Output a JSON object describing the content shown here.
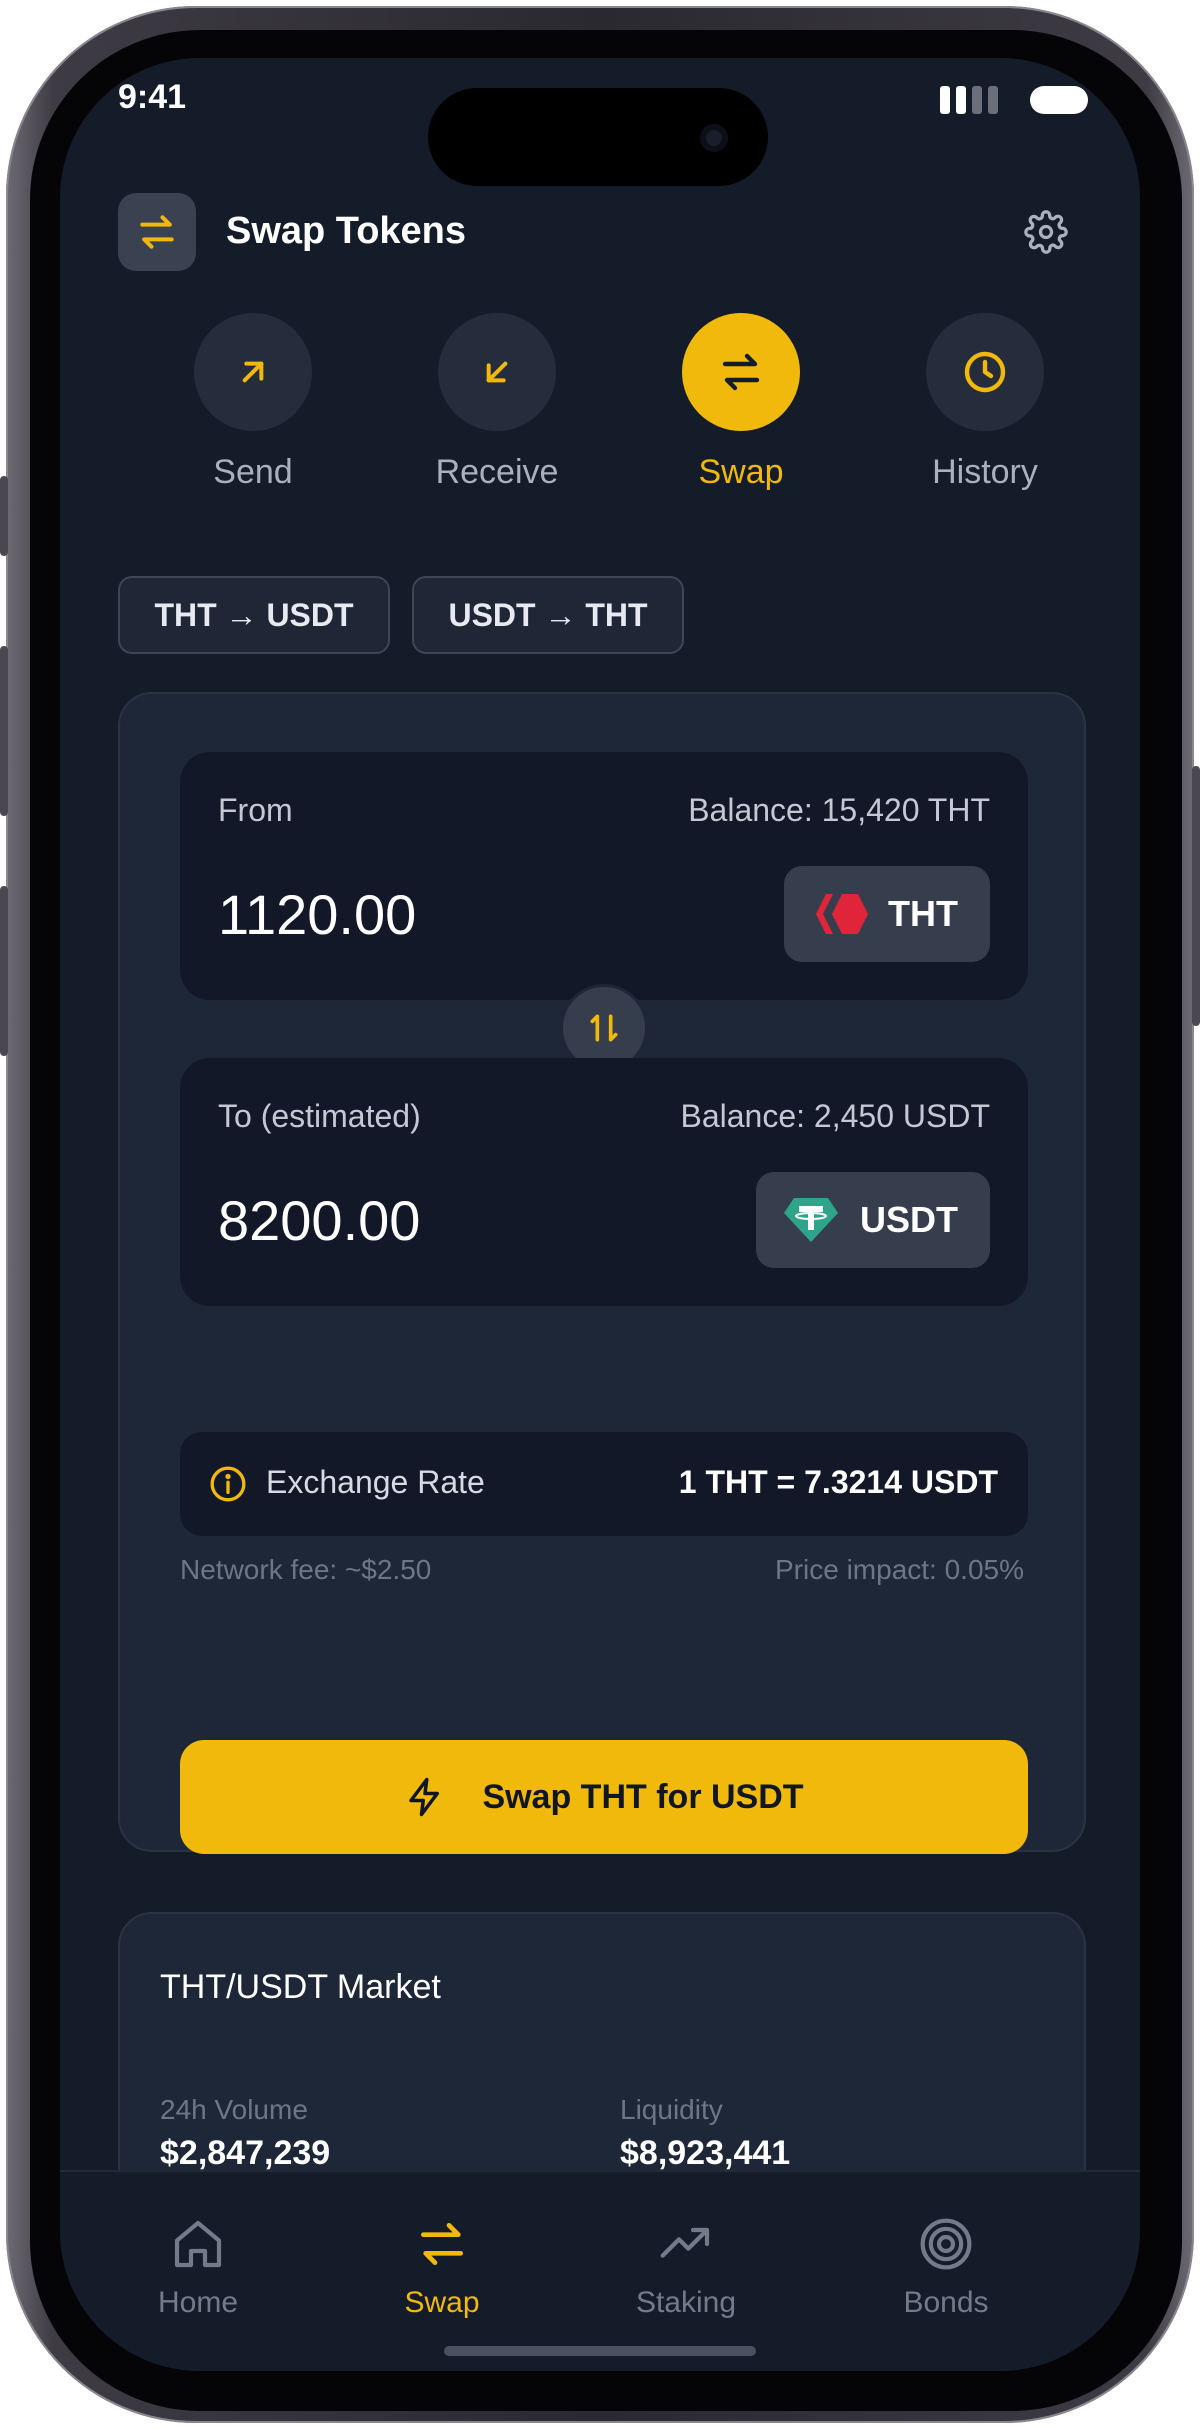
{
  "status_bar": {
    "time": "9:41"
  },
  "header": {
    "title": "Swap Tokens",
    "icon": "swap-arrows-icon",
    "settings_icon": "gear-icon"
  },
  "quick_actions": [
    {
      "label": "Send",
      "icon": "arrow-up-right-icon",
      "active": false
    },
    {
      "label": "Receive",
      "icon": "arrow-down-left-icon",
      "active": false
    },
    {
      "label": "Swap",
      "icon": "swap-arrows-icon",
      "active": true
    },
    {
      "label": "History",
      "icon": "clock-icon",
      "active": false
    }
  ],
  "pair_chips": [
    "THT → USDT",
    "USDT → THT"
  ],
  "swap": {
    "from": {
      "label": "From",
      "balance": "Balance: 15,420 THT",
      "amount": "1120.00",
      "token": "THT"
    },
    "to": {
      "label": "To (estimated)",
      "balance": "Balance: 2,450 USDT",
      "amount": "8200.00",
      "token": "USDT"
    },
    "rate_label": "Exchange Rate",
    "rate_value": "1 THT = 7.3214 USDT",
    "network_fee": "Network fee: ~$2.50",
    "price_impact": "Price impact: 0.05%",
    "button_label": "Swap THT for USDT"
  },
  "market": {
    "title": "THT/USDT Market",
    "stats": [
      {
        "label": "24h Volume",
        "value": "$2,847,239"
      },
      {
        "label": "Liquidity",
        "value": "$8,923,441"
      }
    ]
  },
  "bottom_nav": [
    {
      "label": "Home",
      "icon": "home-icon",
      "active": false
    },
    {
      "label": "Swap",
      "icon": "swap-arrows-icon",
      "active": true
    },
    {
      "label": "Staking",
      "icon": "trending-up-icon",
      "active": false
    },
    {
      "label": "Bonds",
      "icon": "target-icon",
      "active": false
    }
  ],
  "colors": {
    "accent": "#f0b90b",
    "background": "#141b29",
    "card": "#1e2737",
    "panel": "#121828",
    "tht_red": "#e0253b",
    "usdt_green": "#2ea58a"
  }
}
